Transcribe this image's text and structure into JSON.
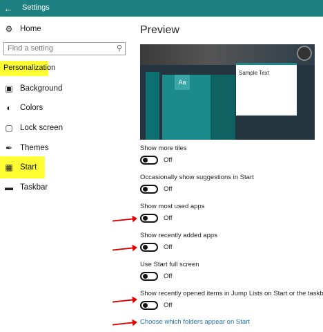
{
  "titlebar": {
    "back_icon": "back-arrow-icon",
    "title": "Settings"
  },
  "sidebar": {
    "home": {
      "label": "Home",
      "icon": "gear-icon"
    },
    "search": {
      "placeholder": "Find a setting",
      "icon": "search-icon"
    },
    "section": "Personalization",
    "items": [
      {
        "label": "Background",
        "icon": "picture-icon"
      },
      {
        "label": "Colors",
        "icon": "palette-icon"
      },
      {
        "label": "Lock screen",
        "icon": "lock-screen-icon"
      },
      {
        "label": "Themes",
        "icon": "brush-icon"
      },
      {
        "label": "Start",
        "icon": "start-icon"
      },
      {
        "label": "Taskbar",
        "icon": "taskbar-icon"
      }
    ],
    "highlight_color": "#ffff33"
  },
  "main": {
    "preview_title": "Preview",
    "preview": {
      "tile_text": "Aa",
      "sample_text": "Sample Text"
    },
    "settings": [
      {
        "label": "Show more tiles",
        "state": "Off"
      },
      {
        "label": "Occasionally show suggestions in Start",
        "state": "Off"
      },
      {
        "label": "Show most used apps",
        "state": "Off"
      },
      {
        "label": "Show recently added apps",
        "state": "Off"
      },
      {
        "label": "Use Start full screen",
        "state": "Off"
      },
      {
        "label": "Show recently opened items in Jump Lists on Start or the taskbar",
        "state": "Off"
      }
    ],
    "link": "Choose which folders appear on Start"
  },
  "colors": {
    "accent": "#1d7f7f",
    "link": "#1a6fa8",
    "annotation_arrow": "#dd0000"
  }
}
